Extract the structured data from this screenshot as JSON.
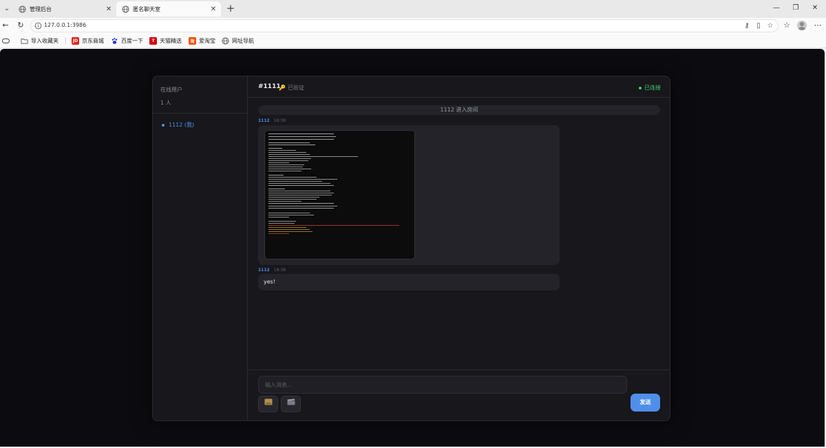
{
  "browser": {
    "tabs": [
      {
        "title": "管理后台",
        "active": false
      },
      {
        "title": "匿名聊天室",
        "active": true
      }
    ],
    "url": "127.0.0.1:3986",
    "bookmarks": [
      {
        "label": "导入收藏夹",
        "icon": "folder-icon"
      },
      {
        "label": "京东商城",
        "icon": "jd-icon",
        "badge": "JD",
        "color": "#e1251b"
      },
      {
        "label": "百度一下",
        "icon": "baidu-icon",
        "color": "#2932e1"
      },
      {
        "label": "天猫精选",
        "icon": "tmall-icon",
        "badge": "T",
        "color": "#d80013"
      },
      {
        "label": "爱淘宝",
        "icon": "taobao-icon",
        "badge": "淘",
        "color": "#ff5000"
      },
      {
        "label": "网址导航",
        "icon": "globe-icon"
      }
    ]
  },
  "sidebar": {
    "title": "在线用户",
    "count": "1 人",
    "users": [
      {
        "name": "1112 (我)",
        "color": "#4f8fea"
      }
    ]
  },
  "header": {
    "room": "#1111",
    "verified": "已验证",
    "status": "已连接",
    "status_color": "#3fcf6a"
  },
  "messages": {
    "system": "1112 进入房间",
    "items": [
      {
        "sender": "1112",
        "time": "18:38",
        "type": "image"
      },
      {
        "sender": "1112",
        "time": "18:38",
        "type": "text",
        "text": "yes!"
      }
    ]
  },
  "composer": {
    "placeholder": "输入消息...",
    "send_label": "发送",
    "accent": "#4f8fea"
  }
}
